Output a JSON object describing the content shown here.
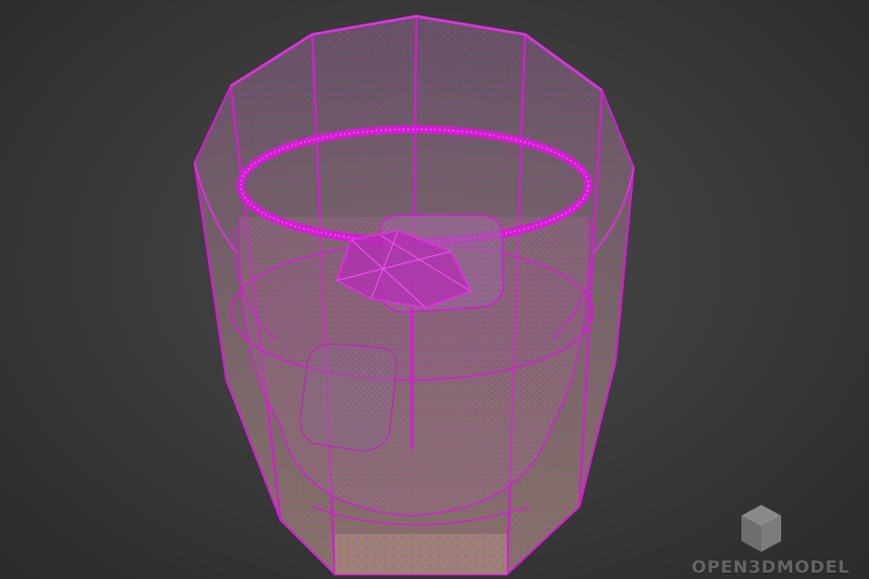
{
  "viewport": {
    "background_color": "#3c3c3c",
    "wire_color": "#d21ed2",
    "glass_tint": "#8a8570",
    "object": "whiskey-glass-with-ice-wireframe"
  },
  "watermark": {
    "text": "OPEN3DMODEL",
    "icon": "cube-logo-icon",
    "color": "#6a6a6a"
  }
}
